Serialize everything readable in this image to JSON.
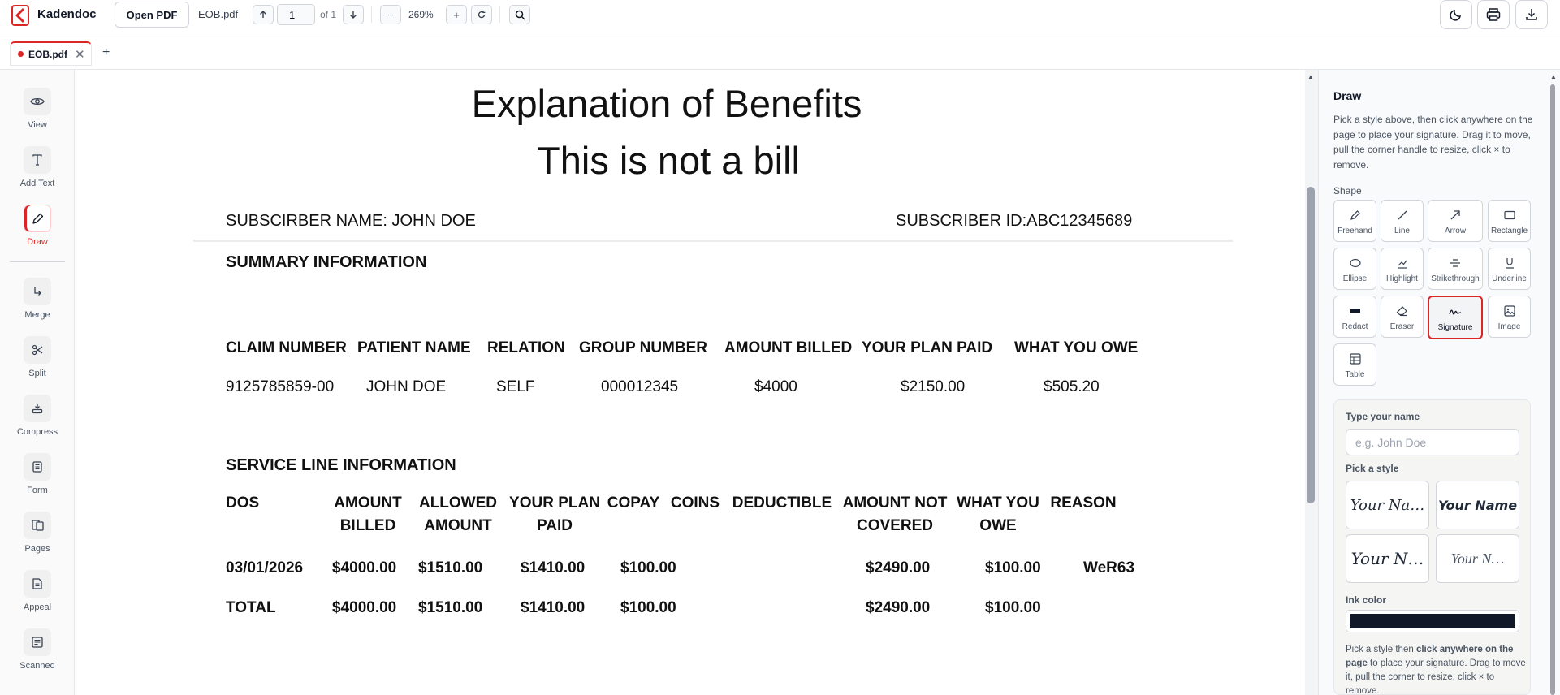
{
  "app": {
    "name": "Kadendoc",
    "open_button": "Open PDF",
    "filename": "EOB.pdf",
    "page_value": "1",
    "page_of": "of 1",
    "zoom": "269%"
  },
  "tabs": [
    {
      "label": "EOB.pdf",
      "close": "✕"
    }
  ],
  "tab_add": "+",
  "rail": [
    {
      "label": "View",
      "icon": "eye-icon"
    },
    {
      "label": "Add Text",
      "icon": "text-icon"
    },
    {
      "label": "Draw",
      "icon": "pencil-icon",
      "active": true
    },
    {
      "label": "Merge",
      "icon": "merge-icon"
    },
    {
      "label": "Split",
      "icon": "scissors-icon"
    },
    {
      "label": "Compress",
      "icon": "compress-icon"
    },
    {
      "label": "Form",
      "icon": "form-icon"
    },
    {
      "label": "Pages",
      "icon": "pages-icon"
    },
    {
      "label": "Appeal",
      "icon": "appeal-icon"
    },
    {
      "label": "Scanned",
      "icon": "scanned-icon"
    }
  ],
  "document": {
    "title": "Explanation of Benefits",
    "subtitle": "This is not a bill",
    "subscriber_name": "SUBSCIRBER NAME: JOHN DOE",
    "subscriber_id": "SUBSCRIBER ID:ABC12345689",
    "summary_heading": "SUMMARY INFORMATION",
    "summary_headers": [
      "CLAIM NUMBER",
      "PATIENT NAME",
      "RELATION",
      "GROUP NUMBER",
      "AMOUNT BILLED",
      "YOUR PLAN PAID",
      "WHAT YOU OWE"
    ],
    "summary_row": [
      "9125785859-00",
      "JOHN DOE",
      "SELF",
      "000012345",
      "$4000",
      "$2150.00",
      "$505.20"
    ],
    "service_heading": "SERVICE LINE INFORMATION",
    "service_headers": [
      [
        "DOS",
        ""
      ],
      [
        "AMOUNT",
        "BILLED"
      ],
      [
        "ALLOWED",
        "AMOUNT"
      ],
      [
        "YOUR PLAN",
        "PAID"
      ],
      [
        "COPAY",
        ""
      ],
      [
        "COINS",
        ""
      ],
      [
        "DEDUCTIBLE",
        ""
      ],
      [
        "AMOUNT NOT",
        "COVERED"
      ],
      [
        "WHAT YOU",
        "OWE"
      ],
      [
        "REASON",
        ""
      ]
    ],
    "service_row": [
      "03/01/2026",
      "$4000.00",
      "$1510.00",
      "$1410.00",
      "$100.00",
      "",
      "",
      "$2490.00",
      "$100.00",
      "WeR63"
    ],
    "total_row": [
      "TOTAL",
      "$4000.00",
      "$1510.00",
      "$1410.00",
      "$100.00",
      "",
      "",
      "$2490.00",
      "$100.00",
      ""
    ]
  },
  "panel": {
    "title": "Draw",
    "help": "Pick a style above, then click anywhere on the page to place your signature. Drag it to move, pull the corner handle to resize, click × to remove.",
    "shape_label": "Shape",
    "tools": [
      {
        "label": "Freehand",
        "icon": "freehand-icon"
      },
      {
        "label": "Line",
        "icon": "line-icon"
      },
      {
        "label": "Arrow",
        "icon": "arrow-icon"
      },
      {
        "label": "Rectangle",
        "icon": "rectangle-icon"
      },
      {
        "label": "Ellipse",
        "icon": "ellipse-icon"
      },
      {
        "label": "Highlight",
        "icon": "highlight-icon"
      },
      {
        "label": "Strikethrough",
        "icon": "strikethrough-icon"
      },
      {
        "label": "Underline",
        "icon": "underline-icon"
      },
      {
        "label": "Redact",
        "icon": "redact-icon"
      },
      {
        "label": "Eraser",
        "icon": "eraser-icon"
      },
      {
        "label": "Signature",
        "icon": "signature-icon",
        "active": true
      },
      {
        "label": "Image",
        "icon": "image-icon"
      },
      {
        "label": "Table",
        "icon": "table-icon"
      }
    ],
    "type_name_label": "Type your name",
    "type_name_placeholder": "e.g. John Doe",
    "pick_style_label": "Pick a style",
    "styles": [
      "Your Na…",
      "Your Name",
      "Your N…",
      "Your N…"
    ],
    "ink_label": "Ink color",
    "ink_color": "#111827",
    "note_prefix": "Pick a style then ",
    "note_bold": "click anywhere on the page",
    "note_suffix": " to place your signature. Drag to move it, pull the corner to resize, click × to remove."
  },
  "colors": {
    "accent": "#dc2626"
  }
}
